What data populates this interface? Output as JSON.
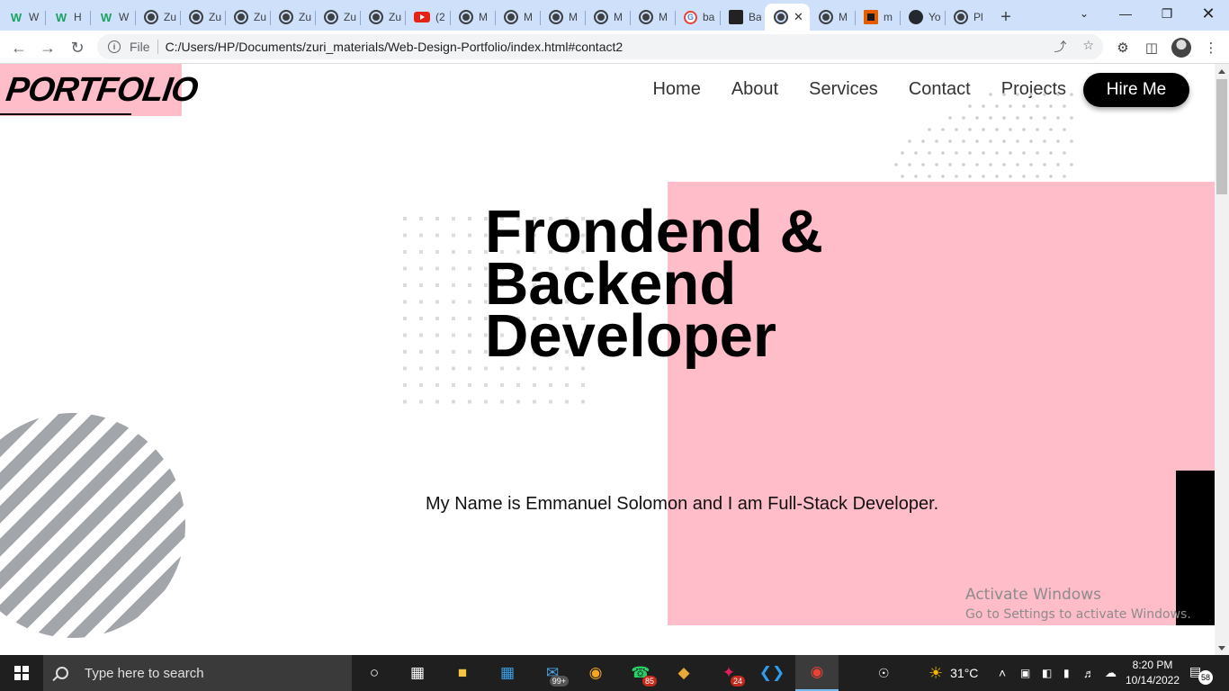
{
  "browser": {
    "tabs": [
      {
        "favicon": "w-logo-icon",
        "title": "W",
        "kind": "w"
      },
      {
        "favicon": "w-logo-icon",
        "title": "H",
        "kind": "w"
      },
      {
        "favicon": "w-logo-icon",
        "title": "W",
        "kind": "w"
      },
      {
        "favicon": "globe-icon",
        "title": "Zu",
        "kind": "globe"
      },
      {
        "favicon": "globe-icon",
        "title": "Zu",
        "kind": "globe"
      },
      {
        "favicon": "globe-icon",
        "title": "Zu",
        "kind": "globe"
      },
      {
        "favicon": "globe-icon",
        "title": "Zu",
        "kind": "globe"
      },
      {
        "favicon": "globe-icon",
        "title": "Zu",
        "kind": "globe"
      },
      {
        "favicon": "globe-icon",
        "title": "Zu",
        "kind": "globe"
      },
      {
        "favicon": "youtube-icon",
        "title": "(2",
        "kind": "yt"
      },
      {
        "favicon": "globe-icon",
        "title": "M",
        "kind": "globe"
      },
      {
        "favicon": "globe-icon",
        "title": "M",
        "kind": "globe"
      },
      {
        "favicon": "globe-icon",
        "title": "M",
        "kind": "globe"
      },
      {
        "favicon": "globe-icon",
        "title": "M",
        "kind": "globe"
      },
      {
        "favicon": "globe-icon",
        "title": "M",
        "kind": "globe"
      },
      {
        "favicon": "google-icon",
        "title": "ba",
        "kind": "g"
      },
      {
        "favicon": "bank-icon",
        "title": "Ba",
        "kind": "sq"
      },
      {
        "favicon": "globe-icon",
        "title": "",
        "kind": "globe",
        "active": true
      },
      {
        "favicon": "globe-icon",
        "title": "M",
        "kind": "globe"
      },
      {
        "favicon": "app-icon",
        "title": "m",
        "kind": "or"
      },
      {
        "favicon": "github-icon",
        "title": "Yo",
        "kind": "gh"
      },
      {
        "favicon": "globe-icon",
        "title": "Pl",
        "kind": "globe"
      }
    ],
    "file_label": "File",
    "url": "C:/Users/HP/Documents/zuri_materials/Web-Design-Portfolio/index.html#contact2"
  },
  "page": {
    "logo": "PORTFOLIO",
    "nav": [
      "Home",
      "About",
      "Services",
      "Contact",
      "Projects"
    ],
    "hire_button": "Hire Me",
    "headline": [
      "Frondend &",
      "Backend",
      "Developer"
    ],
    "tagline": "My Name is Emmanuel Solomon and I am Full-Stack Developer.",
    "accent_color": "#ffbcc9"
  },
  "watermark": {
    "line1": "Activate Windows",
    "line2": "Go to Settings to activate Windows."
  },
  "taskbar": {
    "search_placeholder": "Type here to search",
    "mail_badge": "99+",
    "whatsapp_badge": "85",
    "slack_badge": "24",
    "weather": "31°C",
    "time": "8:20 PM",
    "date": "10/14/2022",
    "notifications": "58"
  }
}
